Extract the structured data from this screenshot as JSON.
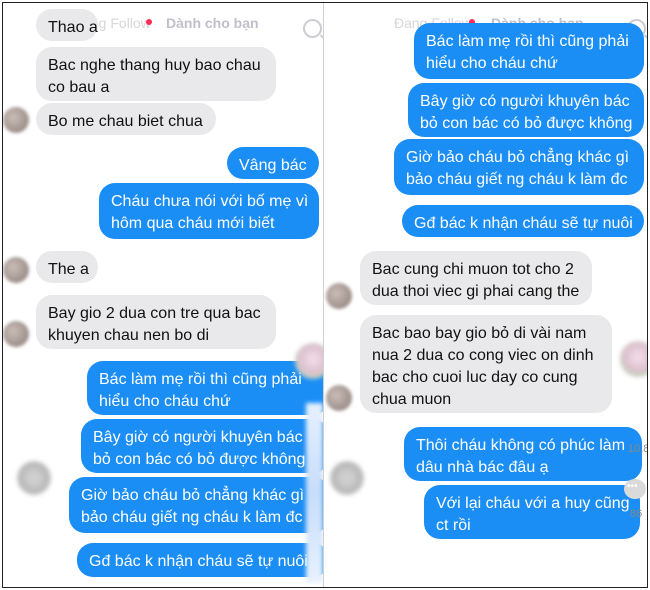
{
  "tabs": {
    "following": "Đang Follow",
    "for_you": "Dành cho bạn"
  },
  "left_messages": [
    {
      "from": "recv",
      "text": [
        "Thao a"
      ]
    },
    {
      "from": "recv",
      "text": [
        "Bac nghe thang huy bao chau",
        "co bau a"
      ]
    },
    {
      "from": "recv",
      "text": [
        "Bo me chau biet chua"
      ]
    },
    {
      "from": "sent",
      "text": [
        "Vâng bác"
      ]
    },
    {
      "from": "sent",
      "text": [
        "Cháu chưa nói với bố mẹ vì",
        "hôm qua cháu mới biết"
      ]
    },
    {
      "from": "recv",
      "text": [
        "The a"
      ]
    },
    {
      "from": "recv",
      "text": [
        "Bay gio 2 dua con tre qua bac",
        "khuyen chau nen bo di"
      ]
    },
    {
      "from": "sent",
      "text": [
        "Bác làm mẹ rồi thì cũng phải",
        "hiểu cho cháu chứ"
      ]
    },
    {
      "from": "sent",
      "text": [
        "Bây giờ có người khuyên bác",
        "bỏ con bác có bỏ được không"
      ]
    },
    {
      "from": "sent",
      "text": [
        "Giờ bảo cháu bỏ chẳng khác gì",
        "bảo cháu giết ng cháu k làm đc"
      ]
    },
    {
      "from": "sent",
      "text": [
        "Gđ bác k nhận cháu sẽ tự nuôi"
      ]
    }
  ],
  "right_messages": [
    {
      "from": "sent",
      "text": [
        "Bác làm mẹ rồi thì cũng phải",
        "hiểu cho cháu chứ"
      ]
    },
    {
      "from": "sent",
      "text": [
        "Bây giờ có người khuyên bác",
        "bỏ con bác có bỏ được không"
      ]
    },
    {
      "from": "sent",
      "text": [
        "Giờ bảo cháu bỏ chẳng khác gì",
        "bảo cháu giết ng cháu k làm đc"
      ]
    },
    {
      "from": "sent",
      "text": [
        "Gđ bác k nhận cháu sẽ tự nuôi"
      ]
    },
    {
      "from": "recv",
      "text": [
        "Bac cung chi muon tot cho 2",
        "dua thoi viec gi phai cang the"
      ]
    },
    {
      "from": "recv",
      "text": [
        "Bac bao bay gio bỏ di vài nam",
        "nua 2 dua co cong viec on dinh",
        "bac cho cuoi luc day co cung",
        "chua muon"
      ]
    },
    {
      "from": "sent",
      "text": [
        "Thôi cháu không có phúc làm",
        "dâu nhà bác đâu ạ"
      ]
    },
    {
      "from": "sent",
      "text": [
        "Với lại cháu với a huy cũng",
        "ct rồi"
      ]
    }
  ],
  "side": {
    "likes": "10,8",
    "comments": "86"
  },
  "colors": {
    "sent": "#1b8ef5",
    "received": "#e9e9eb"
  }
}
